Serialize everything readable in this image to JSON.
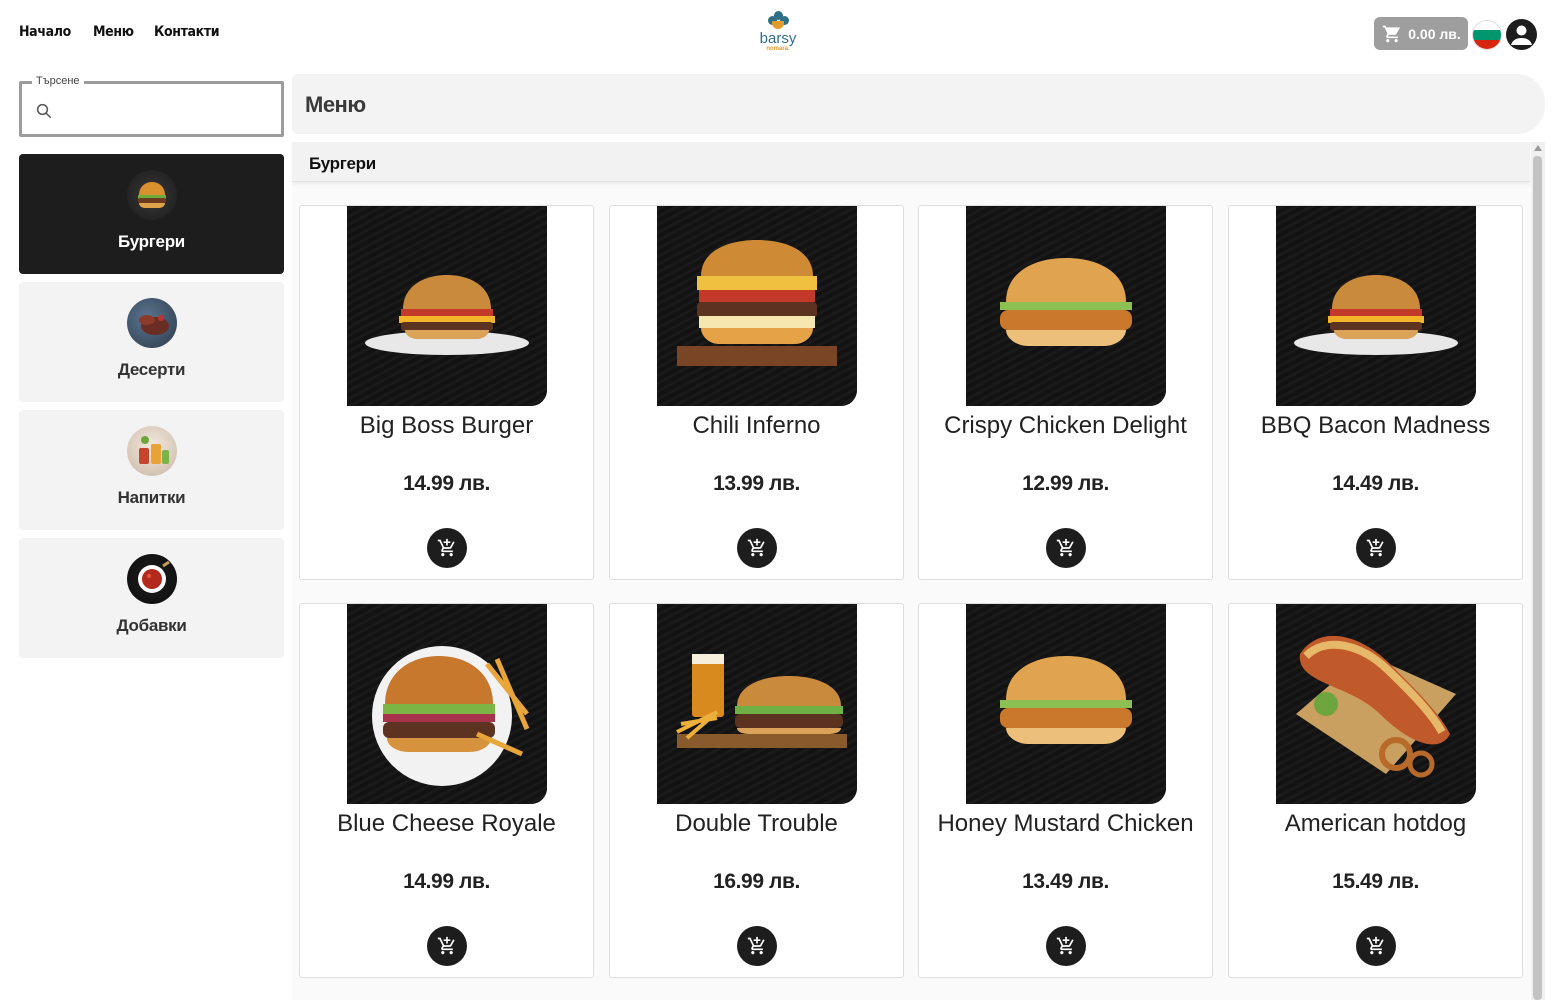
{
  "nav": {
    "home": "Начало",
    "menu": "Меню",
    "contacts": "Контакти"
  },
  "logo": {
    "word": "barsy",
    "sub": "nomara."
  },
  "cart": {
    "total": "0.00 лв.",
    "icon": "cart-icon"
  },
  "search": {
    "label": "Търсене",
    "placeholder": "",
    "value": ""
  },
  "categories": [
    {
      "label": "Бургери",
      "active": true
    },
    {
      "label": "Десерти",
      "active": false
    },
    {
      "label": "Напитки",
      "active": false
    },
    {
      "label": "Добавки",
      "active": false
    }
  ],
  "page": {
    "title": "Меню"
  },
  "section": {
    "title": "Бургери"
  },
  "products": [
    {
      "name": "Big Boss Burger",
      "price": "14.99 лв."
    },
    {
      "name": "Chili Inferno",
      "price": "13.99 лв."
    },
    {
      "name": "Crispy Chicken Delight",
      "price": "12.99 лв."
    },
    {
      "name": "BBQ Bacon Madness",
      "price": "14.49 лв."
    },
    {
      "name": "Blue Cheese Royale",
      "price": "14.99 лв."
    },
    {
      "name": "Double Trouble",
      "price": "16.99 лв."
    },
    {
      "name": "Honey Mustard Chicken",
      "price": "13.49 лв."
    },
    {
      "name": "American hotdog",
      "price": "15.49 лв."
    }
  ],
  "colors": {
    "dark": "#1d1d1d",
    "panel": "#f3f3f3",
    "cart_bg": "#9e9e9e",
    "flag": [
      "#ffffff",
      "#00966e",
      "#d62612"
    ]
  }
}
